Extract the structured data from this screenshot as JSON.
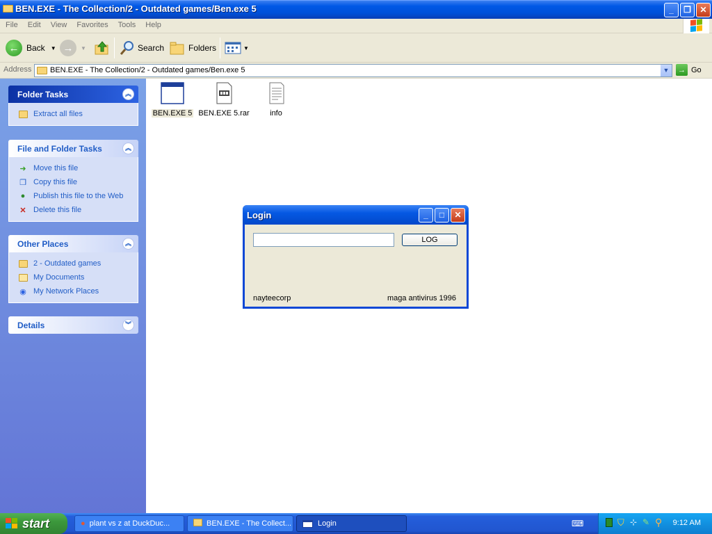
{
  "window": {
    "title": "BEN.EXE - The Collection/2 - Outdated games/Ben.exe 5"
  },
  "menu": [
    "File",
    "Edit",
    "View",
    "Favorites",
    "Tools",
    "Help"
  ],
  "toolbar": {
    "back": "Back",
    "search": "Search",
    "folders": "Folders"
  },
  "address": {
    "label": "Address",
    "value": "BEN.EXE - The Collection/2 - Outdated games/Ben.exe 5",
    "go": "Go"
  },
  "sidebar": {
    "folder_tasks": {
      "title": "Folder Tasks",
      "items": [
        "Extract all files"
      ]
    },
    "file_tasks": {
      "title": "File and Folder Tasks",
      "items": [
        "Move this file",
        "Copy this file",
        "Publish this file to the Web",
        "Delete this file"
      ]
    },
    "other_places": {
      "title": "Other Places",
      "items": [
        "2 - Outdated games",
        "My Documents",
        "My Network Places"
      ]
    },
    "details": {
      "title": "Details"
    }
  },
  "files": [
    "BEN.EXE 5",
    "BEN.EXE 5.rar",
    "info"
  ],
  "login": {
    "title": "Login",
    "button": "LOG",
    "footer_left": "nayteecorp",
    "footer_right": "maga antivirus 1996"
  },
  "taskbar": {
    "start": "start",
    "tasks": [
      "plant vs z at DuckDuc...",
      "BEN.EXE - The Collect...",
      "Login"
    ],
    "clock": "9:12 AM"
  },
  "colors": {
    "title_blue": "#0058e6",
    "sidebar_link": "#215dc6",
    "start_green": "#3c983c",
    "tray_blue": "#1291e0"
  }
}
